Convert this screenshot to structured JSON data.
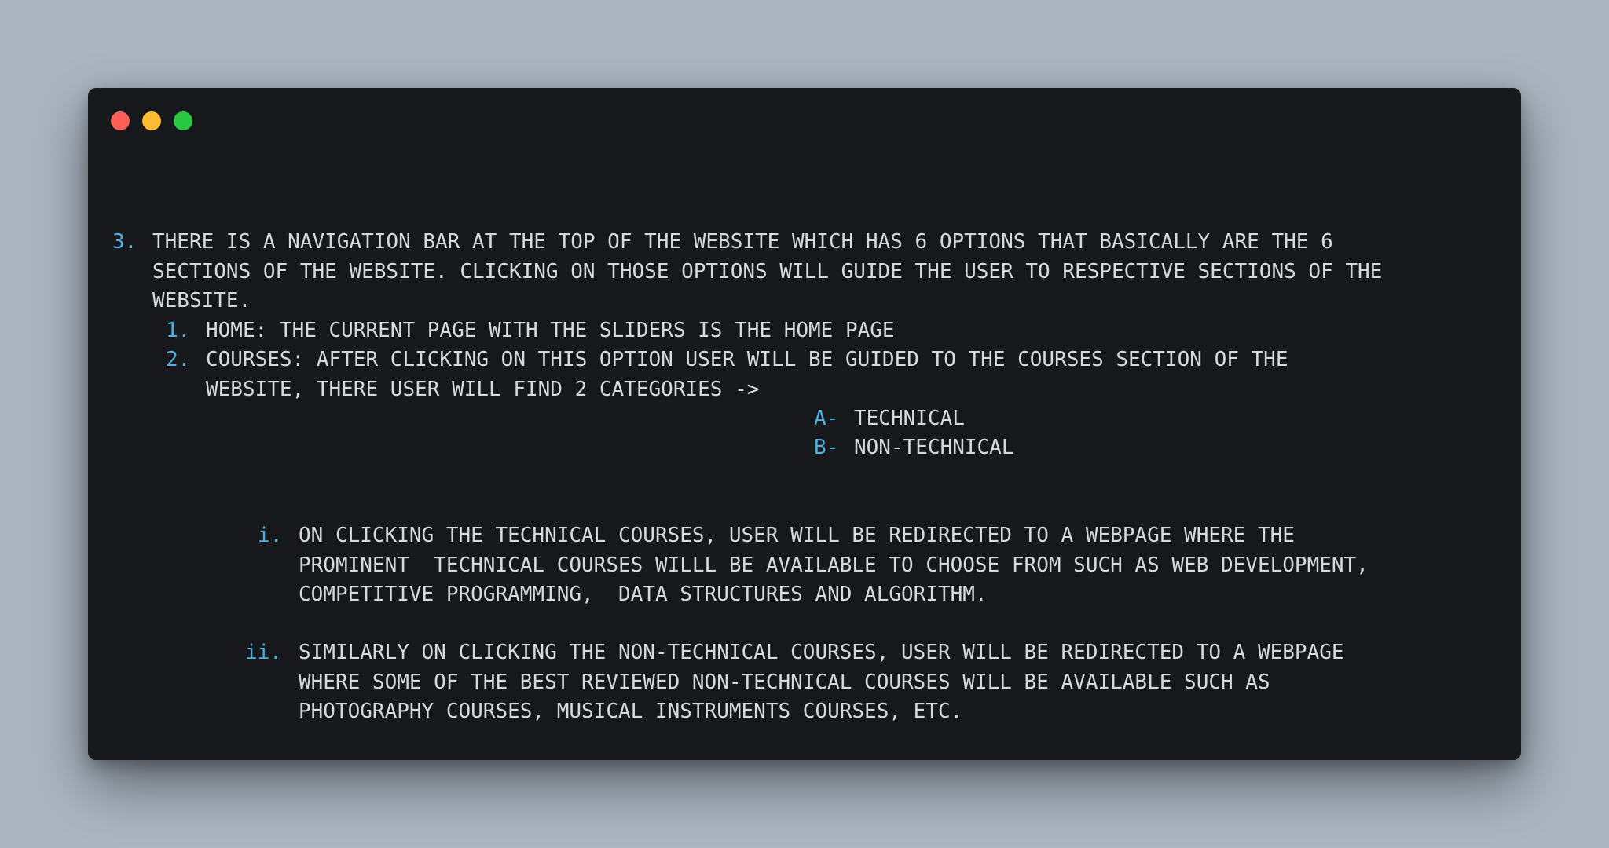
{
  "window": {
    "controls": [
      "close",
      "minimize",
      "maximize"
    ]
  },
  "item3": {
    "number": "3.",
    "lines": [
      "THERE IS A NAVIGATION BAR AT THE TOP OF THE WEBSITE WHICH HAS 6 OPTIONS THAT BASICALLY ARE THE 6",
      "SECTIONS OF THE WEBSITE. CLICKING ON THOSE OPTIONS WILL GUIDE THE USER TO RESPECTIVE SECTIONS OF THE",
      "WEBSITE."
    ]
  },
  "sub1": {
    "number": "1.",
    "text": "HOME: THE CURRENT PAGE WITH THE SLIDERS IS THE HOME PAGE"
  },
  "sub2": {
    "number": "2.",
    "lines": [
      "COURSES: AFTER CLICKING ON THIS OPTION USER WILL BE GUIDED TO THE COURSES SECTION OF THE",
      "WEBSITE, THERE USER WILL FIND 2 CATEGORIES ->"
    ]
  },
  "categories": [
    {
      "marker": "A-",
      "label": "TECHNICAL"
    },
    {
      "marker": "B-",
      "label": "NON-TECHNICAL"
    }
  ],
  "roman_i": {
    "number": "i.",
    "lines": [
      "ON CLICKING THE TECHNICAL COURSES, USER WILL BE REDIRECTED TO A WEBPAGE WHERE THE",
      "PROMINENT  TECHNICAL COURSES WILLL BE AVAILABLE TO CHOOSE FROM SUCH AS WEB DEVELOPMENT,",
      "COMPETITIVE PROGRAMMING,  DATA STRUCTURES AND ALGORITHM."
    ]
  },
  "roman_ii": {
    "number": "ii.",
    "lines": [
      "SIMILARLY ON CLICKING THE NON-TECHNICAL COURSES, USER WILL BE REDIRECTED TO A WEBPAGE",
      "WHERE SOME OF THE BEST REVIEWED NON-TECHNICAL COURSES WILL BE AVAILABLE SUCH AS",
      "PHOTOGRAPHY COURSES, MUSICAL INSTRUMENTS COURSES, ETC."
    ]
  },
  "colors": {
    "background": "#aab5c1",
    "window": "#17181b",
    "text": "#d6d8dc",
    "marker": "#4fb1e0",
    "close": "#fe5f57",
    "minimize": "#febc2e",
    "maximize": "#28c840"
  }
}
